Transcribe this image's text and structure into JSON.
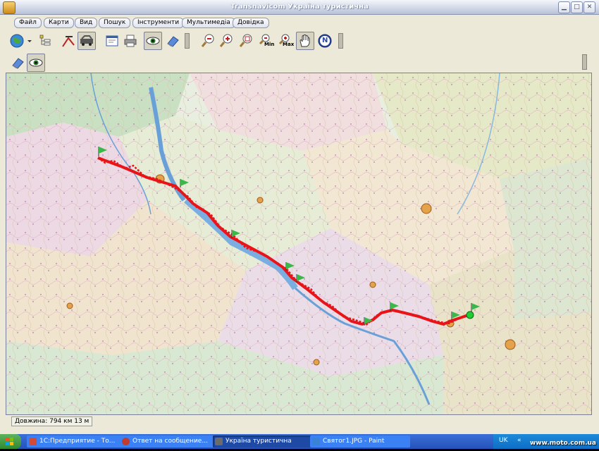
{
  "window": {
    "title": "Transnavicom Україна туристична"
  },
  "menu": [
    "Файл",
    "Карти",
    "Вид",
    "Пошук",
    "Інструменти",
    "Мультимедіа",
    "Довідка"
  ],
  "toolbar": {
    "zoom_min_label": "Min",
    "zoom_max_label": "Max",
    "north_label": "N"
  },
  "status": {
    "length": "Довжина: 794 км 13 м"
  },
  "taskbar": {
    "items": [
      {
        "label": "1С:Предприятие - То...",
        "color": "#d24a3a"
      },
      {
        "label": "Ответ на сообщение...",
        "color": "#c23b2c"
      },
      {
        "label": "Україна туристична",
        "color": "#6b6b6b"
      },
      {
        "label": "Святог1.JPG - Paint",
        "color": "#3a82d8"
      }
    ],
    "lang": "UK",
    "watermark": "www.moto.com.ua"
  },
  "colors": {
    "route": "#e8141a",
    "flag": "#3cb84a",
    "endpoint": "#22cc33"
  }
}
